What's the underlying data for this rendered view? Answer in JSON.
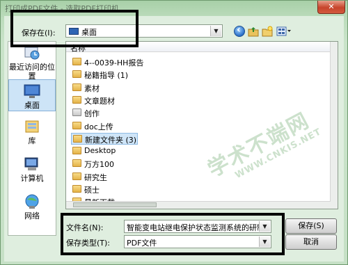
{
  "window": {
    "title": "打印成PDF文件 - 选取PDF打印机",
    "close_label": "✕"
  },
  "look_in": {
    "label": "保存在(I):",
    "value": "桌面"
  },
  "toolbar": {
    "back_icon": "back-arrow-icon",
    "up_icon": "up-folder-icon",
    "new_folder_icon": "new-folder-icon",
    "views_icon": "view-menu-icon"
  },
  "places": [
    {
      "label": "最近访问的位置",
      "icon": "recent-places-icon"
    },
    {
      "label": "桌面",
      "icon": "desktop-icon",
      "selected": true
    },
    {
      "label": "库",
      "icon": "libraries-icon"
    },
    {
      "label": "计算机",
      "icon": "computer-icon"
    },
    {
      "label": "网络",
      "icon": "network-icon"
    }
  ],
  "file_list": {
    "column_name": "名称",
    "items": [
      {
        "name": "4--0039-HH报告",
        "type": "folder"
      },
      {
        "name": "秘籍指导 (1)",
        "type": "folder"
      },
      {
        "name": "素材",
        "type": "folder"
      },
      {
        "name": "文章题材",
        "type": "folder"
      },
      {
        "name": "创作",
        "type": "special"
      },
      {
        "name": "doc上传",
        "type": "folder"
      },
      {
        "name": "新建文件夹 (3)",
        "type": "folder",
        "selected": true
      },
      {
        "name": "Desktop",
        "type": "folder"
      },
      {
        "name": "万方100",
        "type": "folder"
      },
      {
        "name": "研究生",
        "type": "folder"
      },
      {
        "name": "硕士",
        "type": "folder"
      },
      {
        "name": "最新下载",
        "type": "folder"
      }
    ]
  },
  "file_name": {
    "label": "文件名(N):",
    "value": "智能变电站继电保护状态监测系统的研制-"
  },
  "file_type": {
    "label": "保存类型(T):",
    "value": "PDF文件"
  },
  "buttons": {
    "save": "保存(S)",
    "cancel": "取消"
  },
  "watermark": {
    "text": "学术不端网",
    "url": "WWW.CNKIS.NET"
  }
}
